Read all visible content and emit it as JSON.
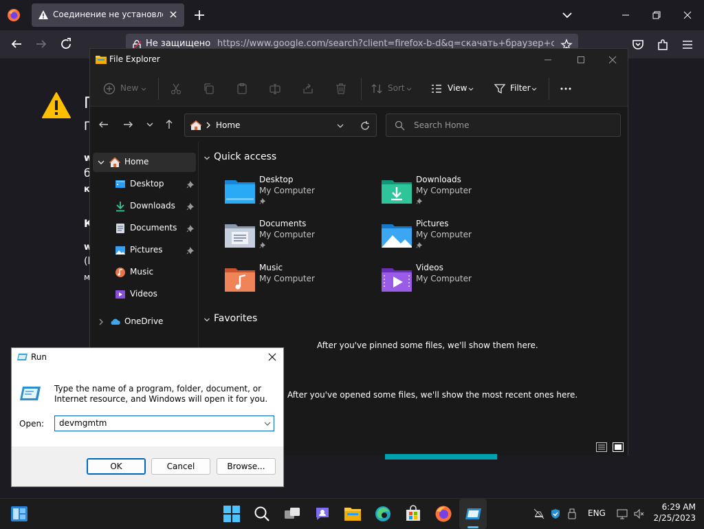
{
  "firefox": {
    "tab_title": "Соединение не установлено: (",
    "security_label": "Не защищено",
    "url": "https://www.google.com/search?client=firefox-b-d&q=скачать+браузер+ceht",
    "page_fragments": {
      "heading_1": "П",
      "heading_2": "П",
      "line_1": "w",
      "line_2": "б",
      "line_3": "к",
      "line_4": "К",
      "line_5": "w",
      "line_6": "(l",
      "line_7": "м"
    }
  },
  "explorer": {
    "title": "File Explorer",
    "toolbar": {
      "new_label": "New",
      "sort_label": "Sort",
      "view_label": "View",
      "filter_label": "Filter"
    },
    "address": "Home",
    "search_placeholder": "Search Home",
    "nav": {
      "home": "Home",
      "desktop": "Desktop",
      "downloads": "Downloads",
      "documents": "Documents",
      "pictures": "Pictures",
      "music": "Music",
      "videos": "Videos",
      "onedrive": "OneDrive"
    },
    "quick_access_title": "Quick access",
    "quick_access": [
      {
        "name": "Desktop",
        "location": "My Computer",
        "pinned": true
      },
      {
        "name": "Downloads",
        "location": "My Computer",
        "pinned": true
      },
      {
        "name": "Documents",
        "location": "My Computer",
        "pinned": true
      },
      {
        "name": "Pictures",
        "location": "My Computer",
        "pinned": true
      },
      {
        "name": "Music",
        "location": "My Computer",
        "pinned": false
      },
      {
        "name": "Videos",
        "location": "My Computer",
        "pinned": false
      }
    ],
    "favorites_title": "Favorites",
    "favorites_empty": "After you've pinned some files, we'll show them here.",
    "recent_empty": "After you've opened some files, we'll show the most recent ones here."
  },
  "run_dialog": {
    "title": "Run",
    "description": "Type the name of a program, folder, document, or Internet resource, and Windows will open it for you.",
    "open_label": "Open:",
    "open_value": "devmgmtm",
    "ok_label": "OK",
    "cancel_label": "Cancel",
    "browse_label": "Browse..."
  },
  "taskbar": {
    "language": "ENG",
    "time": "6:29 AM",
    "date": "2/25/2023"
  },
  "colors": {
    "firefox_bg": "#1c1b22",
    "explorer_bg": "#191919",
    "accent": "#0067c0",
    "warning": "#ffbf00"
  }
}
